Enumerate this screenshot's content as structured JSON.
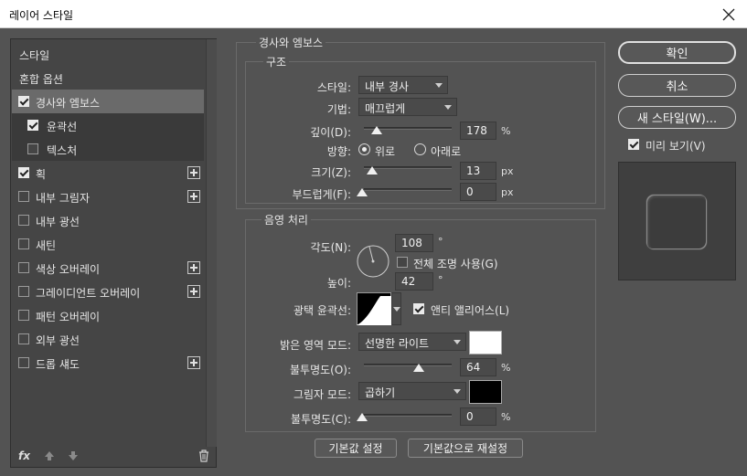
{
  "window": {
    "title": "레이어 스타일"
  },
  "left_panel": {
    "items": [
      {
        "label": "스타일",
        "checkbox": false,
        "checked": false,
        "plus": false,
        "style": "plain"
      },
      {
        "label": "혼합 옵션",
        "checkbox": false,
        "checked": false,
        "plus": false,
        "style": "plain"
      },
      {
        "label": "경사와 엠보스",
        "checkbox": true,
        "checked": true,
        "plus": false,
        "style": "sel"
      },
      {
        "label": "윤곽선",
        "checkbox": true,
        "checked": true,
        "plus": false,
        "style": "sub"
      },
      {
        "label": "텍스처",
        "checkbox": true,
        "checked": false,
        "plus": false,
        "style": "sub"
      },
      {
        "label": "획",
        "checkbox": true,
        "checked": true,
        "plus": true,
        "style": "norm"
      },
      {
        "label": "내부 그림자",
        "checkbox": true,
        "checked": false,
        "plus": true,
        "style": "norm"
      },
      {
        "label": "내부 광선",
        "checkbox": true,
        "checked": false,
        "plus": false,
        "style": "norm"
      },
      {
        "label": "새틴",
        "checkbox": true,
        "checked": false,
        "plus": false,
        "style": "norm"
      },
      {
        "label": "색상 오버레이",
        "checkbox": true,
        "checked": false,
        "plus": true,
        "style": "norm"
      },
      {
        "label": "그레이디언트 오버레이",
        "checkbox": true,
        "checked": false,
        "plus": true,
        "style": "norm"
      },
      {
        "label": "패턴 오버레이",
        "checkbox": true,
        "checked": false,
        "plus": false,
        "style": "norm"
      },
      {
        "label": "외부 광선",
        "checkbox": true,
        "checked": false,
        "plus": false,
        "style": "norm"
      },
      {
        "label": "드롭 섀도",
        "checkbox": true,
        "checked": false,
        "plus": true,
        "style": "norm"
      }
    ],
    "footer_fx": "fx"
  },
  "bevel": {
    "section_title": "경사와 엠보스",
    "structure_title": "구조",
    "style_label": "스타일:",
    "style_value": "내부 경사",
    "technique_label": "기법:",
    "technique_value": "매끄럽게",
    "depth_label": "깊이(D):",
    "depth_value": "178",
    "depth_unit": "%",
    "direction_label": "방향:",
    "direction_up": "위로",
    "direction_down": "아래로",
    "direction_selected": "up",
    "size_label": "크기(Z):",
    "size_value": "13",
    "size_unit": "px",
    "soften_label": "부드럽게(F):",
    "soften_value": "0",
    "soften_unit": "px"
  },
  "shading": {
    "title": "음영 처리",
    "angle_label": "각도(N):",
    "angle_value": "108",
    "degree": "°",
    "global_light_label": "전체 조명 사용(G)",
    "global_light_checked": false,
    "altitude_label": "높이:",
    "altitude_value": "42",
    "gloss_label": "광택 윤곽선:",
    "antialias_label": "앤티 앨리어스(L)",
    "antialias_checked": true,
    "highlight_mode_label": "밝은 영역 모드:",
    "highlight_mode_value": "선명한 라이트",
    "highlight_color": "#ffffff",
    "highlight_opacity_label": "불투명도(O):",
    "highlight_opacity_value": "64",
    "shadow_mode_label": "그림자 모드:",
    "shadow_mode_value": "곱하기",
    "shadow_color": "#000000",
    "shadow_opacity_label": "불투명도(C):",
    "shadow_opacity_value": "0",
    "opacity_unit": "%"
  },
  "bottom_buttons": {
    "make_default": "기본값 설정",
    "reset_default": "기본값으로 재설정"
  },
  "right_buttons": {
    "ok": "확인",
    "cancel": "취소",
    "new_style": "새 스타일(W)...",
    "preview_label": "미리 보기(V)",
    "preview_checked": true
  }
}
